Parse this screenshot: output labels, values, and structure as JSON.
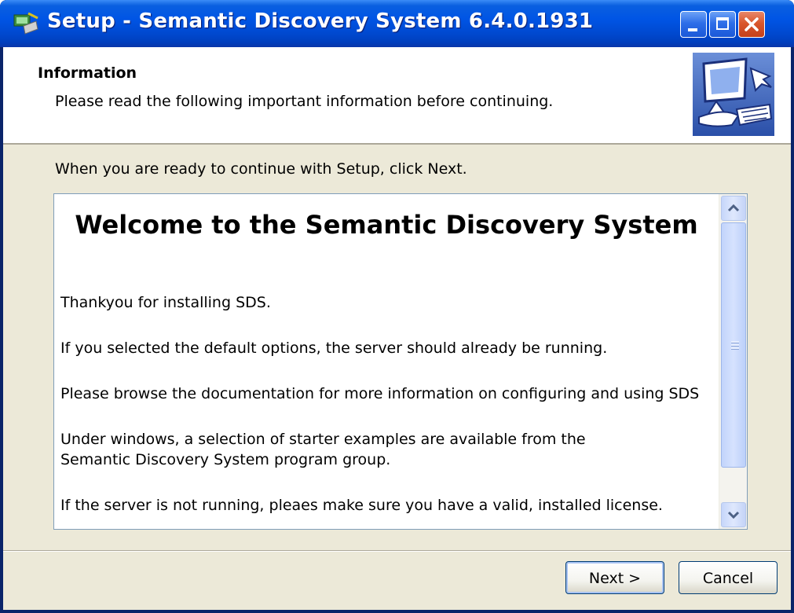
{
  "window": {
    "title": "Setup - Semantic Discovery System 6.4.0.1931",
    "controls": [
      "minimize",
      "maximize",
      "close"
    ]
  },
  "header": {
    "title": "Information",
    "subtitle": "Please read the following important information before continuing.",
    "icon": "wizard-computer-icon"
  },
  "instruction": "When you are ready to continue with Setup, click Next.",
  "info": {
    "heading": "Welcome to the Semantic Discovery System",
    "paragraphs": [
      "Thankyou for installing SDS.",
      "If you selected the default options, the server should already be running.",
      "Please browse the documentation for more information on configuring and using SDS",
      "Under windows, a selection of starter examples are available from the",
      "Semantic Discovery System program group.",
      "If the server is not running, pleaes make sure you have a valid, installed license."
    ]
  },
  "buttons": {
    "next": "Next >",
    "cancel": "Cancel"
  },
  "colors": {
    "titlebar": "#0055e5",
    "dialog_bg": "#ece9d8",
    "close_button": "#d9572c",
    "scrollbar": "#c6d6fa"
  }
}
